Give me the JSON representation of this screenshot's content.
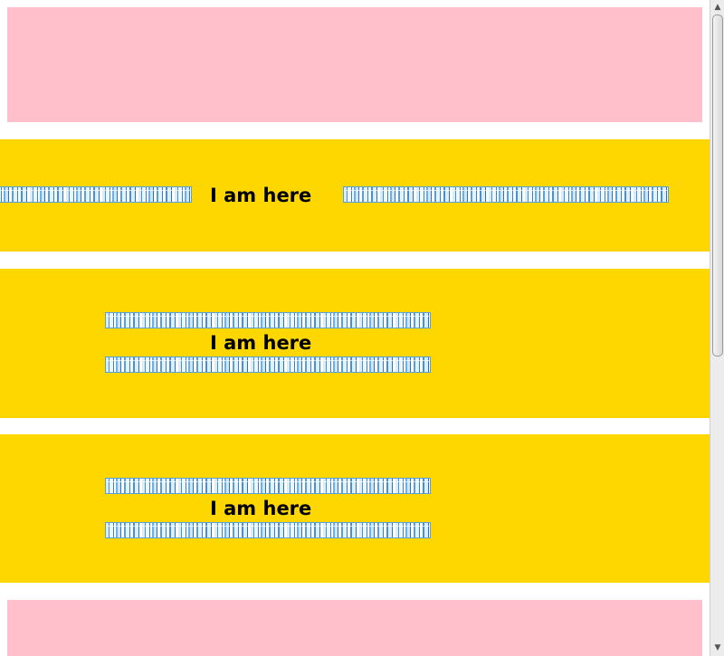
{
  "blocks": {
    "band_1": {
      "label": "I am here"
    },
    "band_2": {
      "label": "I am here"
    },
    "band_3": {
      "label": "I am here"
    }
  },
  "colors": {
    "pink": "#ffc0cb",
    "yellow": "#ffd700",
    "strip_blue": "#5aa0d8"
  },
  "scrollbar": {
    "up_arrow_icon": "▲",
    "down_arrow_icon": "▼"
  }
}
